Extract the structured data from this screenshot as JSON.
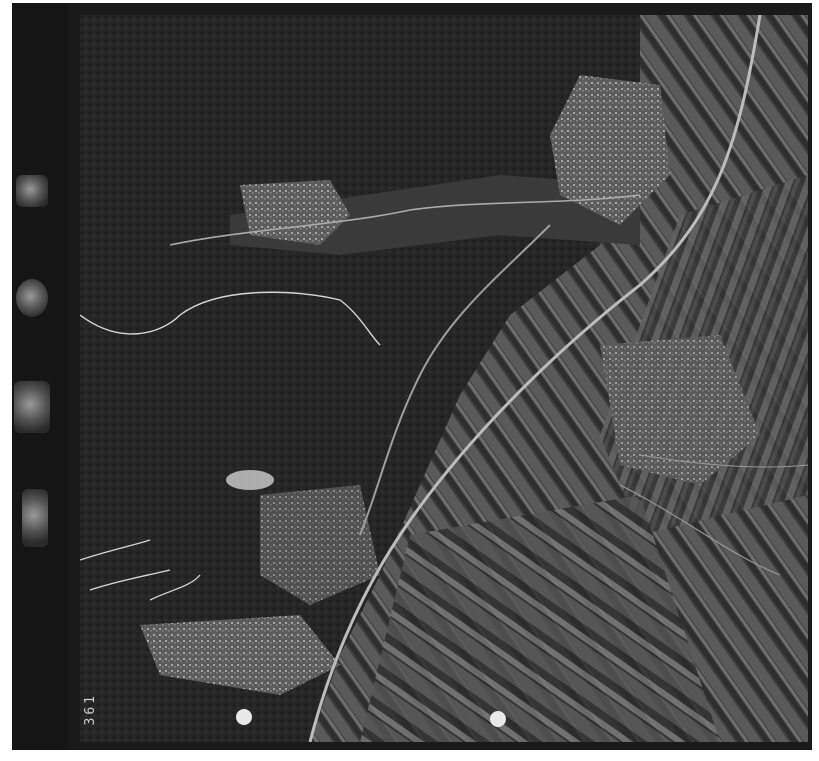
{
  "image": {
    "description_free": true,
    "frame_number": "361"
  },
  "colors": {
    "film_border": "#1a1a1a",
    "terrain_dark": "#262626",
    "fields_mid": "#4a4a4a",
    "fields_light": "#777777",
    "roads": "#bdbdbd",
    "settlement": "#9a9a9a"
  }
}
